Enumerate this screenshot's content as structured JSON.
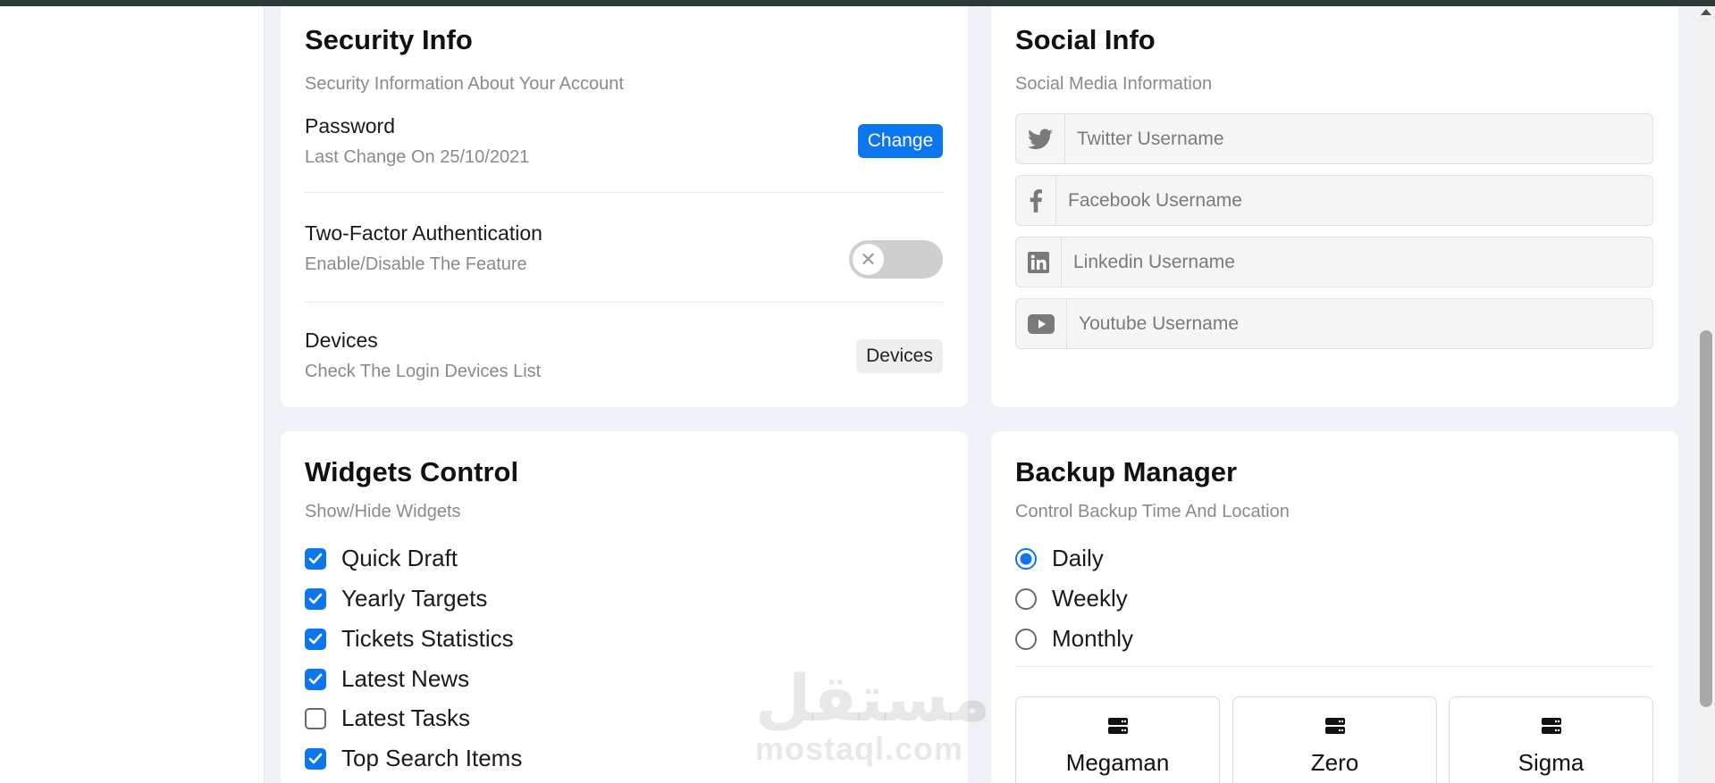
{
  "security": {
    "title": "Security Info",
    "subtitle": "Security Information About Your Account",
    "password_title": "Password",
    "password_sub": "Last Change On 25/10/2021",
    "change_label": "Change",
    "twofa_title": "Two-Factor Authentication",
    "twofa_sub": "Enable/Disable The Feature",
    "twofa_enabled": false,
    "devices_title": "Devices",
    "devices_sub": "Check The Login Devices List",
    "devices_label": "Devices"
  },
  "social": {
    "title": "Social Info",
    "subtitle": "Social Media Information",
    "fields": [
      {
        "icon": "twitter-icon",
        "placeholder": "Twitter Username",
        "value": ""
      },
      {
        "icon": "facebook-icon",
        "placeholder": "Facebook Username",
        "value": ""
      },
      {
        "icon": "linkedin-icon",
        "placeholder": "Linkedin Username",
        "value": ""
      },
      {
        "icon": "youtube-icon",
        "placeholder": "Youtube Username",
        "value": ""
      }
    ]
  },
  "widgets": {
    "title": "Widgets Control",
    "subtitle": "Show/Hide Widgets",
    "items": [
      {
        "label": "Quick Draft",
        "checked": true
      },
      {
        "label": "Yearly Targets",
        "checked": true
      },
      {
        "label": "Tickets Statistics",
        "checked": true
      },
      {
        "label": "Latest News",
        "checked": true
      },
      {
        "label": "Latest Tasks",
        "checked": false
      },
      {
        "label": "Top Search Items",
        "checked": true
      }
    ]
  },
  "backup": {
    "title": "Backup Manager",
    "subtitle": "Control Backup Time And Location",
    "options": [
      {
        "label": "Daily",
        "selected": true
      },
      {
        "label": "Weekly",
        "selected": false
      },
      {
        "label": "Monthly",
        "selected": false
      }
    ],
    "servers": [
      {
        "label": "Megaman"
      },
      {
        "label": "Zero"
      },
      {
        "label": "Sigma"
      }
    ]
  },
  "colors": {
    "accent": "#0b76ef",
    "background": "#eef1f5"
  },
  "watermark": {
    "arabic": "مستقل",
    "latin": "mostaql.com"
  }
}
